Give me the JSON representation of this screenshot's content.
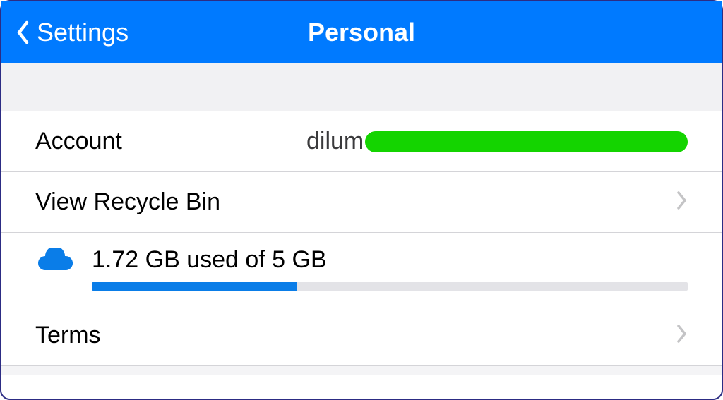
{
  "header": {
    "back_label": "Settings",
    "title": "Personal"
  },
  "rows": {
    "account": {
      "label": "Account",
      "value_prefix": "dilum"
    },
    "recycle_bin": {
      "label": "View Recycle Bin"
    },
    "storage": {
      "text": "1.72 GB used of 5 GB",
      "used_gb": 1.72,
      "total_gb": 5,
      "percent": 34.4
    },
    "terms": {
      "label": "Terms"
    }
  },
  "colors": {
    "header_bg": "#007aff",
    "progress_fill": "#0a7de8",
    "redaction": "#14d400"
  }
}
